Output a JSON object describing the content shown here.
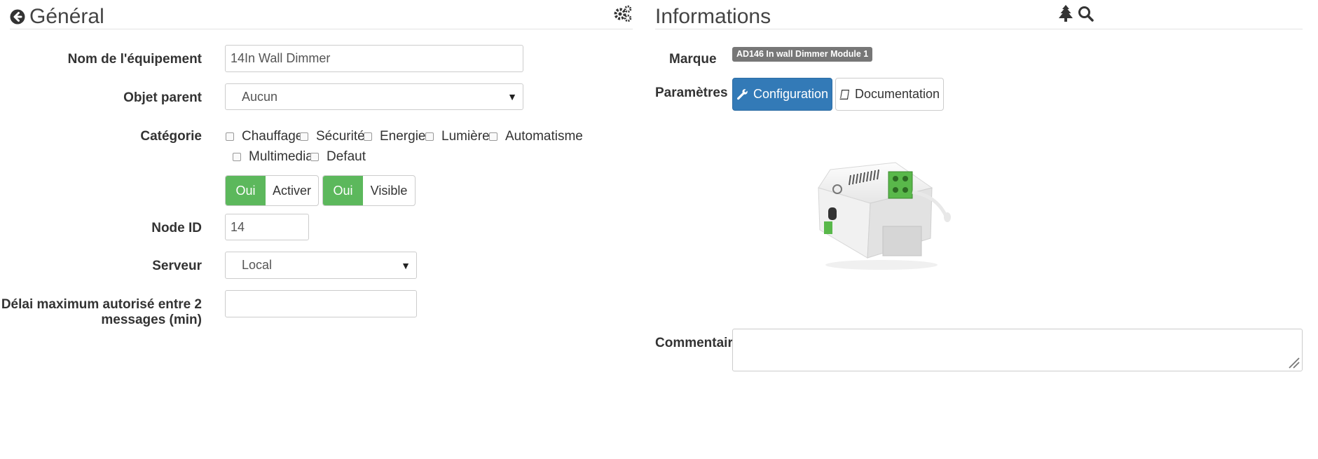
{
  "general": {
    "title": "Général",
    "fields": {
      "name_label": "Nom de l'équipement",
      "name_value": "14In Wall Dimmer",
      "parent_label": "Objet parent",
      "parent_value": "Aucun",
      "category_label": "Catégorie",
      "categories": [
        "Chauffage",
        "Sécurité",
        "Energie",
        "Lumière",
        "Automatisme",
        "Multimedia",
        "Defaut"
      ],
      "activer_on": "Oui",
      "activer_label": "Activer",
      "visible_on": "Oui",
      "visible_label": "Visible",
      "node_id_label": "Node ID",
      "node_id_value": "14",
      "server_label": "Serveur",
      "server_value": "Local",
      "delay_label_line1": "Délai maximum autorisé entre 2",
      "delay_label_line2": "messages (min)",
      "delay_value": ""
    }
  },
  "informations": {
    "title": "Informations",
    "brand_label": "Marque",
    "brand_badge": "AD146 In wall Dimmer Module 1",
    "params_label": "Paramètres",
    "config_button": "Configuration",
    "doc_button": "Documentation",
    "comment_label": "Commentaire",
    "comment_value": ""
  },
  "icons": {
    "back": "arrow-circle-left-icon",
    "gears": "cogs-icon",
    "tree": "tree-icon",
    "search": "search-icon",
    "wrench": "wrench-icon",
    "book": "book-icon"
  },
  "colors": {
    "success": "#5cb85c",
    "primary": "#337ab7",
    "badge": "#777777"
  }
}
